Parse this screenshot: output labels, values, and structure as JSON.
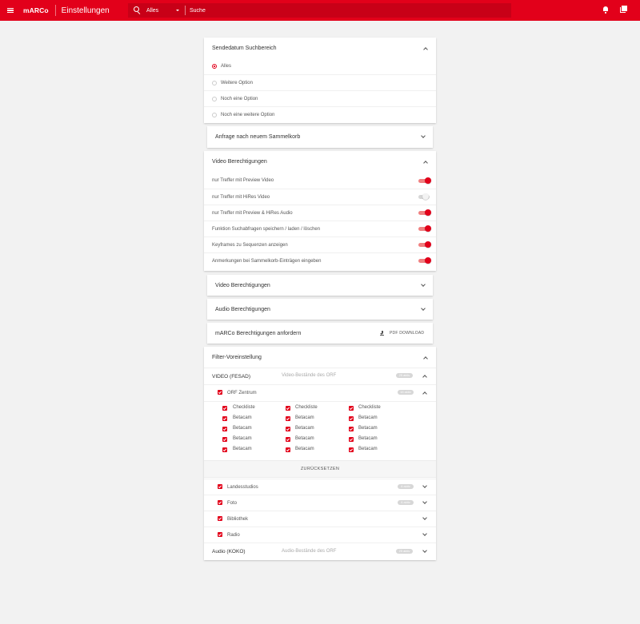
{
  "topbar": {
    "brand": "mARCo",
    "title": "Einstellungen",
    "search_scope": "Alles",
    "search_placeholder": "Suche",
    "icons": [
      "menu-icon",
      "search-icon",
      "bell-icon",
      "library-icon"
    ],
    "accent_color": "#e2001a"
  },
  "sendedatum": {
    "title": "Sendedatum Suchbereich",
    "options": [
      {
        "label": "Alles",
        "selected": true
      },
      {
        "label": "Weitere Option",
        "selected": false
      },
      {
        "label": "Noch eine Option",
        "selected": false
      },
      {
        "label": "Noch eine weitere Option",
        "selected": false
      }
    ]
  },
  "sammelkorb": {
    "title": "Anfrage nach neuem Sammelkorb"
  },
  "video_perm": {
    "title": "Video Berechtigungen",
    "toggles": [
      {
        "label": "nur Treffer mit Preview Video",
        "on": true
      },
      {
        "label": "nur Treffer mit HiRes Video",
        "on": false
      },
      {
        "label": "nur Treffer mit Preview & HiRes Audio",
        "on": true
      },
      {
        "label": "Funktion Suchabfragen speichern / laden / löschen",
        "on": true
      },
      {
        "label": "Keyframes zu Sequenzen anzeigen",
        "on": true
      },
      {
        "label": "Anmerkungen bei Sammelkorb-Einträgen eingeben",
        "on": true
      }
    ]
  },
  "video_perm_2": {
    "title": "Video Berechtigungen"
  },
  "audio_perm": {
    "title": "Audio Berechtigungen"
  },
  "marco_perm": {
    "title": "mARCo Berechtigungen anfordern",
    "download_label": "PDF DOWNLOAD"
  },
  "filter": {
    "title": "Filter-Voreinstellung",
    "video_row": {
      "label": "VIDEO (FESAD)",
      "desc": "Video-Bestände des ORF",
      "badge": "25 aktiv"
    },
    "orf_row": {
      "label": "ORF Zentrum",
      "badge": "16 aktiv"
    },
    "grid": [
      [
        "Checkliste",
        "Checkliste",
        "Checkliste"
      ],
      [
        "Betacam",
        "Betacam",
        "Betacam"
      ],
      [
        "Betacam",
        "Betacam",
        "Betacam"
      ],
      [
        "Betacam",
        "Betacam",
        "Betacam"
      ],
      [
        "Betacam",
        "Betacam",
        "Betacam"
      ]
    ],
    "reset_label": "ZURÜCKSETZEN",
    "sub_rows": [
      {
        "label": "Landesstudios",
        "badge": "6 aktiv"
      },
      {
        "label": "Foto",
        "badge": "6 aktiv"
      },
      {
        "label": "Bibliothek",
        "badge": ""
      },
      {
        "label": "Radio",
        "badge": ""
      }
    ],
    "audio_row": {
      "label": "Audio (KOKO)",
      "desc": "Audio-Bestände des ORF",
      "badge": "25 aktiv"
    }
  }
}
